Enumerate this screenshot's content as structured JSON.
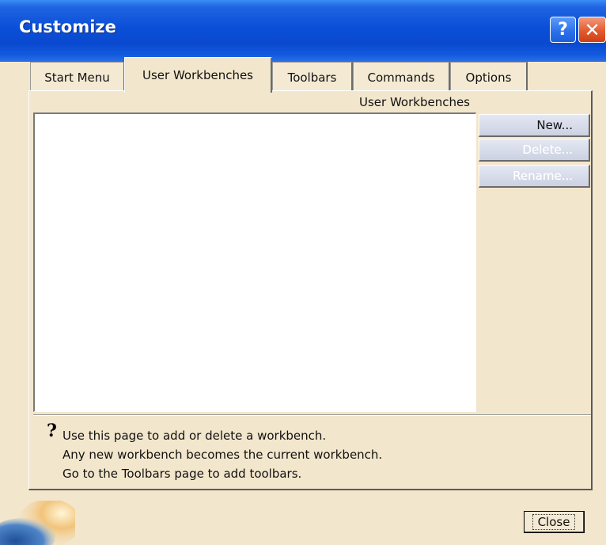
{
  "window": {
    "title": "Customize",
    "help_glyph": "?",
    "close_glyph": "✕"
  },
  "tabs": [
    {
      "label": "Start Menu",
      "active": false
    },
    {
      "label": "User Workbenches",
      "active": true
    },
    {
      "label": "Toolbars",
      "active": false
    },
    {
      "label": "Commands",
      "active": false
    },
    {
      "label": "Options",
      "active": false
    }
  ],
  "panel": {
    "label": "User Workbenches",
    "buttons": {
      "new": "New...",
      "delete": "Delete...",
      "rename": "Rename..."
    }
  },
  "help": {
    "icon": "?",
    "lines": [
      "Use this page to add or delete a workbench.",
      "Any new workbench becomes the current workbench.",
      "Go to the Toolbars page to add toolbars."
    ]
  },
  "footer": {
    "close_label": "Close"
  },
  "colors": {
    "title_blue": "#0a4fd8",
    "dialog_bg": "#f2e6cc",
    "button_face": "#ccd1e2"
  }
}
